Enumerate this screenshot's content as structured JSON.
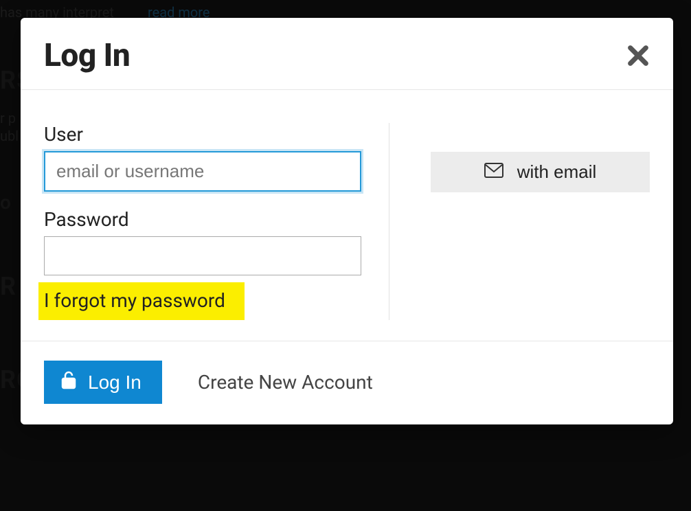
{
  "background": {
    "snippet1": "has many interpret",
    "read_more": "read more",
    "heading1": "RS",
    "snippet2": "r p",
    "snippet3": "ubl",
    "snippet4": "o",
    "heading2": "R",
    "heading3": "RC"
  },
  "dialog": {
    "title": "Log In",
    "user_label": "User",
    "user_placeholder": "email or username",
    "password_label": "Password",
    "forgot_label": "I forgot my password",
    "email_btn_label": "with email",
    "login_btn_label": "Log In",
    "create_account_label": "Create New Account"
  }
}
